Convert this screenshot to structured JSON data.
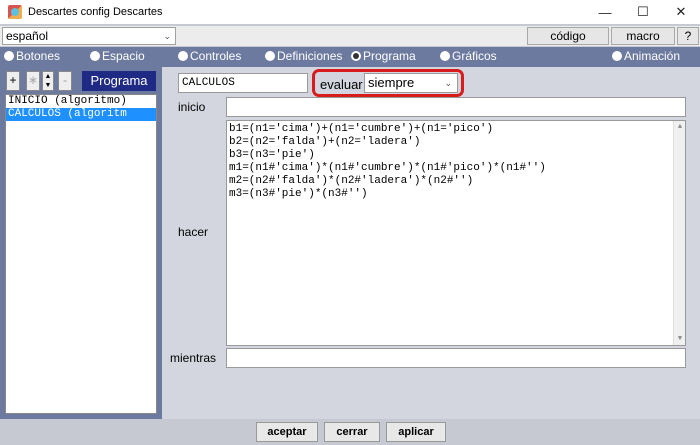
{
  "window": {
    "title": "Descartes config Descartes",
    "controls": {
      "minimize": "—",
      "maximize": "☐",
      "close": "✕"
    }
  },
  "toolbar": {
    "language": "español",
    "codigo_label": "código",
    "macro_label": "macro",
    "help_label": "?"
  },
  "tabs": [
    {
      "label": "Botones",
      "selected": false
    },
    {
      "label": "Espacio",
      "selected": false
    },
    {
      "label": "Controles",
      "selected": false
    },
    {
      "label": "Definiciones",
      "selected": false
    },
    {
      "label": "Programa",
      "selected": true
    },
    {
      "label": "Gráficos",
      "selected": false
    },
    {
      "label": "Animación",
      "selected": false
    }
  ],
  "left_panel": {
    "add_label": "+",
    "remove_label": "-",
    "section_title": "Programa",
    "items": [
      {
        "label": "INICIO (algoritmo)",
        "selected": false
      },
      {
        "label": "CALCULOS (algoritm",
        "selected": true
      }
    ]
  },
  "editor": {
    "name_value": "CALCULOS",
    "evaluar_label": "evaluar",
    "evaluar_value": "siempre",
    "inicio_label": "inicio",
    "inicio_value": "",
    "hacer_label": "hacer",
    "hacer_lines": [
      "b1=(n1='cima')+(n1='cumbre')+(n1='pico')",
      "b2=(n2='falda')+(n2='ladera')",
      "b3=(n3='pie')",
      "m1=(n1#'cima')*(n1#'cumbre')*(n1#'pico')*(n1#'')",
      "m2=(n2#'falda')*(n2#'ladera')*(n2#'')",
      "m3=(n3#'pie')*(n3#'')"
    ],
    "mientras_label": "mientras",
    "mientras_value": ""
  },
  "footer": {
    "aceptar_label": "aceptar",
    "cerrar_label": "cerrar",
    "aplicar_label": "aplicar"
  },
  "colors": {
    "panel": "#6c7aa0",
    "highlight_border": "#d81c1c",
    "selection": "#1e90ff",
    "section_title_bg": "#1f2a85"
  }
}
